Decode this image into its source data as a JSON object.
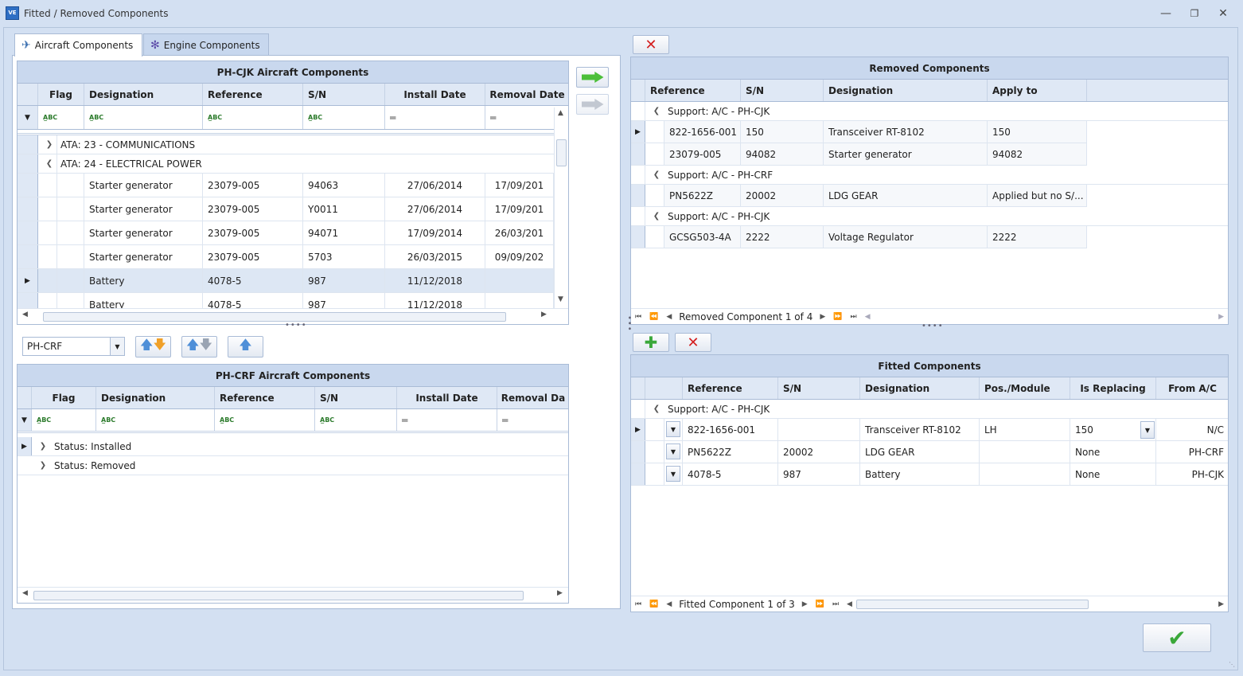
{
  "window": {
    "title": "Fitted / Removed Components",
    "app_icon": "ve-app-icon",
    "controls": [
      "minimize-icon",
      "restore-icon",
      "close-icon"
    ]
  },
  "tabs": [
    {
      "label": "Aircraft Components",
      "active": true,
      "icon": "plane-icon"
    },
    {
      "label": "Engine Components",
      "active": false,
      "icon": "engine-icon"
    }
  ],
  "top_grid": {
    "title": "PH-CJK Aircraft Components",
    "columns": [
      "Flag",
      "Designation",
      "Reference",
      "S/N",
      "Install Date",
      "Removal Date"
    ],
    "groups": [
      {
        "label": "ATA: 23 - COMMUNICATIONS",
        "expanded": false
      },
      {
        "label": "ATA: 24 - ELECTRICAL POWER",
        "expanded": true
      }
    ],
    "rows": [
      {
        "designation": "Starter generator",
        "reference": "23079-005",
        "sn": "94063",
        "install": "27/06/2014",
        "removal": "17/09/201"
      },
      {
        "designation": "Starter generator",
        "reference": "23079-005",
        "sn": "Y0011",
        "install": "27/06/2014",
        "removal": "17/09/201"
      },
      {
        "designation": "Starter generator",
        "reference": "23079-005",
        "sn": "94071",
        "install": "17/09/2014",
        "removal": "26/03/201"
      },
      {
        "designation": "Starter generator",
        "reference": "23079-005",
        "sn": "5703",
        "install": "26/03/2015",
        "removal": "09/09/202"
      },
      {
        "designation": "Battery",
        "reference": "4078-5",
        "sn": "987",
        "install": "11/12/2018",
        "removal": ""
      },
      {
        "designation": "Battery",
        "reference": "4078-5",
        "sn": "987",
        "install": "11/12/2018",
        "removal": ""
      }
    ]
  },
  "aircraft_select": {
    "value": "PH-CRF"
  },
  "bottom_grid": {
    "title": "PH-CRF Aircraft Components",
    "columns": [
      "Flag",
      "Designation",
      "Reference",
      "S/N",
      "Install Date",
      "Removal Da"
    ],
    "groups": [
      {
        "label": "Status: Installed"
      },
      {
        "label": "Status: Removed"
      }
    ]
  },
  "removed": {
    "title": "Removed Components",
    "columns": [
      "Reference",
      "S/N",
      "Designation",
      "Apply to"
    ],
    "groups": [
      {
        "label": "Support: A/C - PH-CJK",
        "rows": [
          {
            "reference": "822-1656-001",
            "sn": "150",
            "designation": "Transceiver RT-8102",
            "apply": "150"
          },
          {
            "reference": "23079-005",
            "sn": "94082",
            "designation": "Starter generator",
            "apply": "94082"
          }
        ]
      },
      {
        "label": "Support: A/C - PH-CRF",
        "rows": [
          {
            "reference": "PN5622Z",
            "sn": "20002",
            "designation": "LDG GEAR",
            "apply": "Applied but no S/..."
          }
        ]
      },
      {
        "label": "Support: A/C - PH-CJK",
        "rows": [
          {
            "reference": "GCSG503-4A",
            "sn": "2222",
            "designation": "Voltage Regulator",
            "apply": "2222"
          }
        ]
      }
    ],
    "nav": "Removed Component 1 of 4"
  },
  "fitted": {
    "title": "Fitted Components",
    "columns": [
      "Reference",
      "S/N",
      "Designation",
      "Pos./Module",
      "Is Replacing",
      "From A/C"
    ],
    "group": "Support: A/C - PH-CJK",
    "rows": [
      {
        "reference": "822-1656-001",
        "sn": "",
        "designation": "Transceiver RT-8102",
        "pos": "LH",
        "replacing": "150",
        "from": "N/C"
      },
      {
        "reference": "PN5622Z",
        "sn": "20002",
        "designation": "LDG GEAR",
        "pos": "",
        "replacing": "None",
        "from": "PH-CRF"
      },
      {
        "reference": "4078-5",
        "sn": "987",
        "designation": "Battery",
        "pos": "",
        "replacing": "None",
        "from": "PH-CJK"
      }
    ],
    "nav": "Fitted Component 1 of 3"
  },
  "colors": {
    "accent": "#c9d8ee",
    "delete": "#d42020",
    "confirm": "#3aa83a"
  }
}
